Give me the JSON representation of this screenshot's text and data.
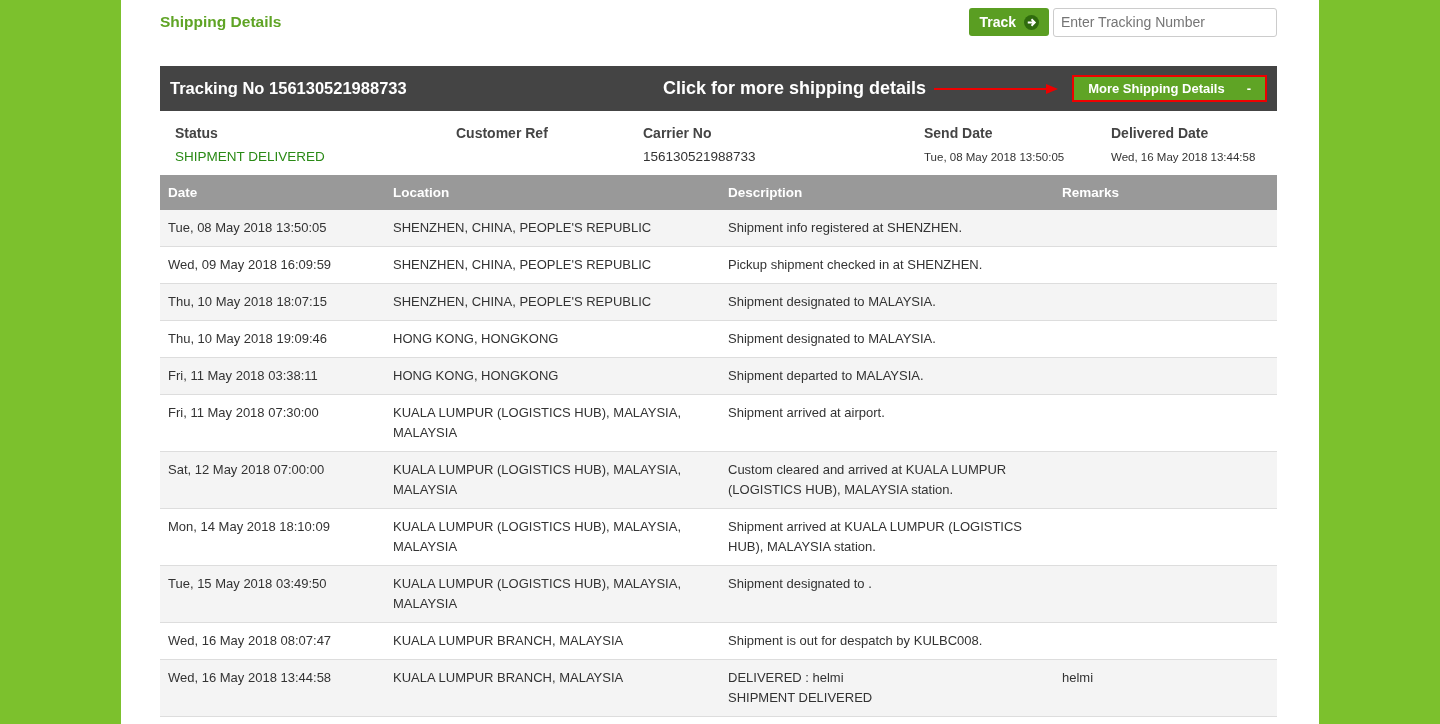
{
  "page_title": "Shipping Details",
  "track": {
    "button": "Track",
    "placeholder": "Enter Tracking Number"
  },
  "tracking_bar": {
    "title": "Tracking No 156130521988733",
    "annotation": "Click for more shipping details",
    "button": "More Shipping Details",
    "button_sign": "-"
  },
  "summary": [
    {
      "label": "Status",
      "value": "SHIPMENT DELIVERED",
      "kind": "status"
    },
    {
      "label": "Customer Ref",
      "kind": "plain"
    },
    {
      "label": "Carrier No",
      "value": "156130521988733",
      "kind": "plain"
    },
    {
      "label": "Send Date",
      "value": "Tue, 08 May 2018 13:50:05",
      "kind": "date"
    },
    {
      "label": "Delivered Date",
      "value": "Wed, 16 May 2018 13:44:58",
      "kind": "date"
    }
  ],
  "table": {
    "columns": [
      "Date",
      "Location",
      "Description",
      "Remarks"
    ],
    "rows": [
      [
        "Tue, 08 May 2018 13:50:05",
        "SHENZHEN, CHINA, PEOPLE'S REPUBLIC",
        "Shipment info registered at SHENZHEN.",
        ""
      ],
      [
        "Wed, 09 May 2018 16:09:59",
        "SHENZHEN, CHINA, PEOPLE'S REPUBLIC",
        "Pickup shipment checked in at SHENZHEN.",
        ""
      ],
      [
        "Thu, 10 May 2018 18:07:15",
        "SHENZHEN, CHINA, PEOPLE'S REPUBLIC",
        "Shipment designated to MALAYSIA.",
        ""
      ],
      [
        "Thu, 10 May 2018 19:09:46",
        "HONG KONG, HONGKONG",
        "Shipment designated to MALAYSIA.",
        ""
      ],
      [
        "Fri, 11 May 2018 03:38:11",
        "HONG KONG, HONGKONG",
        "Shipment departed to MALAYSIA.",
        ""
      ],
      [
        "Fri, 11 May 2018 07:30:00",
        "KUALA LUMPUR (LOGISTICS HUB), MALAYSIA, MALAYSIA",
        "Shipment arrived at airport.",
        ""
      ],
      [
        "Sat, 12 May 2018 07:00:00",
        "KUALA LUMPUR (LOGISTICS HUB), MALAYSIA, MALAYSIA",
        "Custom cleared and arrived at KUALA LUMPUR (LOGISTICS HUB), MALAYSIA station.",
        ""
      ],
      [
        "Mon, 14 May 2018 18:10:09",
        "KUALA LUMPUR (LOGISTICS HUB), MALAYSIA, MALAYSIA",
        "Shipment arrived at KUALA LUMPUR (LOGISTICS HUB), MALAYSIA station.",
        ""
      ],
      [
        "Tue, 15 May 2018 03:49:50",
        "KUALA LUMPUR (LOGISTICS HUB), MALAYSIA, MALAYSIA",
        "Shipment designated to .",
        ""
      ],
      [
        "Wed, 16 May 2018 08:07:47",
        "KUALA LUMPUR BRANCH, MALAYSIA",
        "Shipment is out for despatch by KULBC008.",
        ""
      ],
      [
        "Wed, 16 May 2018 13:44:58",
        "KUALA LUMPUR BRANCH, MALAYSIA",
        "DELIVERED : helmi\nSHIPMENT DELIVERED",
        "helmi"
      ]
    ]
  }
}
